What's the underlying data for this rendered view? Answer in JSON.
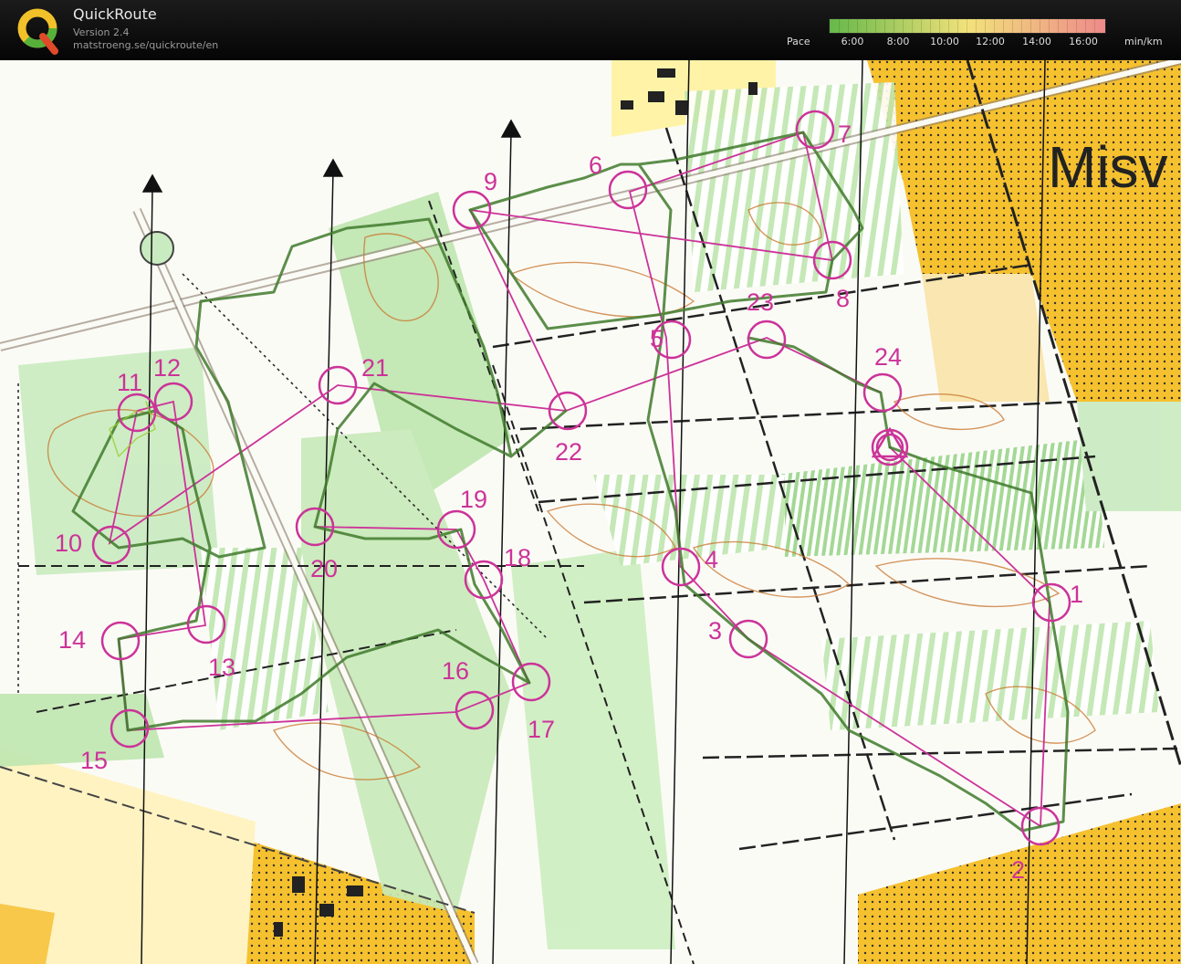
{
  "app": {
    "title": "QuickRoute",
    "version": "Version 2.4",
    "url": "matstroeng.se/quickroute/en",
    "logo_letter": "Q"
  },
  "pace_scale": {
    "label": "Pace",
    "unit": "min/km",
    "ticks": [
      "6:00",
      "8:00",
      "10:00",
      "12:00",
      "14:00",
      "16:00"
    ],
    "colors": {
      "fast": "#66b84a",
      "mid": "#f2e27a",
      "slow": "#ee8a8a"
    }
  },
  "map": {
    "place_label": "Misv",
    "course_color": "#cc3399",
    "route_color": "#3f7a2c",
    "controls": [
      {
        "label": "1"
      },
      {
        "label": "2"
      },
      {
        "label": "3"
      },
      {
        "label": "4"
      },
      {
        "label": "5"
      },
      {
        "label": "6"
      },
      {
        "label": "7"
      },
      {
        "label": "8"
      },
      {
        "label": "9"
      },
      {
        "label": "10"
      },
      {
        "label": "11"
      },
      {
        "label": "12"
      },
      {
        "label": "13"
      },
      {
        "label": "14"
      },
      {
        "label": "15"
      },
      {
        "label": "16"
      },
      {
        "label": "17"
      },
      {
        "label": "18"
      },
      {
        "label": "19"
      },
      {
        "label": "20"
      },
      {
        "label": "21"
      },
      {
        "label": "22"
      },
      {
        "label": "23"
      },
      {
        "label": "24"
      }
    ]
  }
}
